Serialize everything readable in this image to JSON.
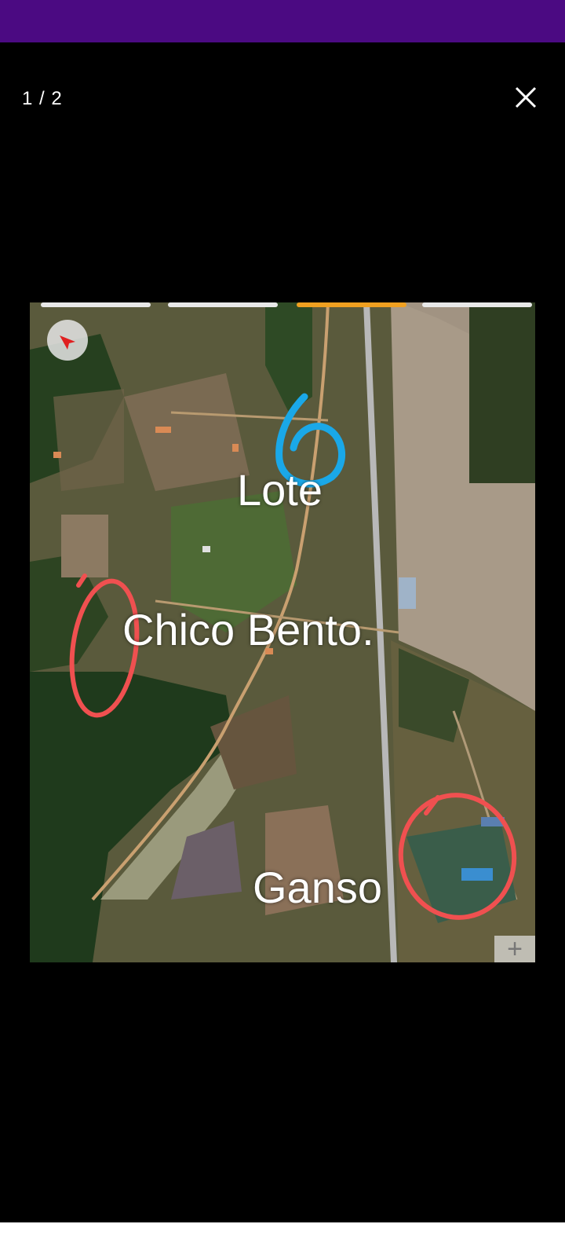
{
  "colors": {
    "status_bar": "#4b0a82",
    "viewer_bg": "#000000",
    "bottom_bar": "#ffffff",
    "annotation_blue": "#1aa8e8",
    "annotation_red": "#f05050"
  },
  "viewer": {
    "counter": "1 / 2",
    "close_icon": "close-icon"
  },
  "photo": {
    "labels": {
      "lote": "Lote",
      "chico_bento": "Chico Bento.",
      "ganso": "Ganso"
    },
    "compass_icon": "compass-icon",
    "zoom_icon": "+"
  }
}
